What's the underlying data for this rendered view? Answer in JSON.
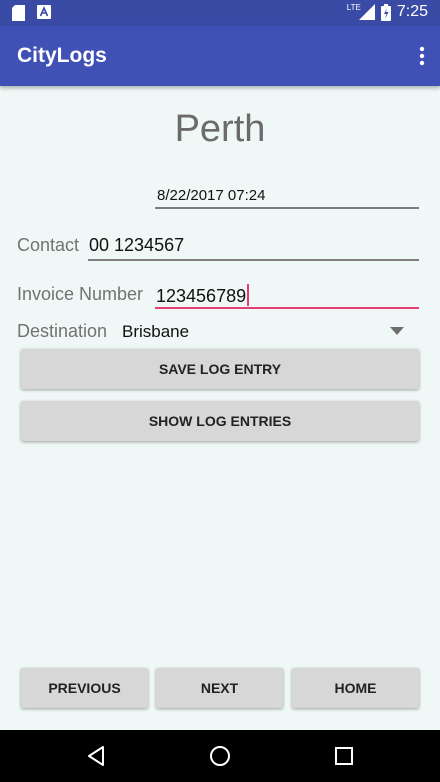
{
  "status_bar": {
    "time": "7:25",
    "network_label": "LTE",
    "icons": [
      "sd-card-icon",
      "app-notification-icon",
      "signal-icon",
      "battery-icon"
    ]
  },
  "app_bar": {
    "title": "CityLogs",
    "menu_icon": "overflow-menu-icon"
  },
  "main": {
    "city": "Perth",
    "datetime": "8/22/2017 07:24",
    "contact": {
      "label": "Contact",
      "value": "00 1234567"
    },
    "invoice": {
      "label": "Invoice Number",
      "value": "123456789"
    },
    "destination": {
      "label": "Destination",
      "selected": "Brisbane"
    },
    "save_button": "SAVE LOG ENTRY",
    "show_button": "SHOW LOG ENTRIES"
  },
  "footer": {
    "previous": "PREVIOUS",
    "next": "NEXT",
    "home": "HOME"
  },
  "nav_bar": {
    "icons": [
      "back-icon",
      "home-circle-icon",
      "recents-icon"
    ]
  },
  "colors": {
    "status_bar": "#3a4ba6",
    "app_bar": "#3f51b5",
    "background": "#eff8f6",
    "accent": "#e43d74",
    "button": "#d7d7d7"
  }
}
